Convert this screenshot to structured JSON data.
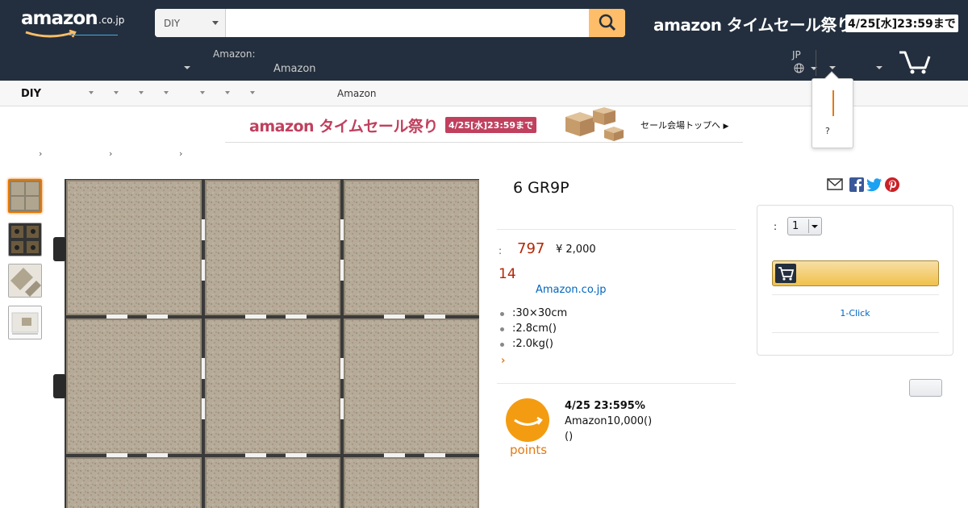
{
  "header": {
    "logo_text": "amazon",
    "logo_tld": ".co.jp",
    "search": {
      "category": "DIY",
      "placeholder": "",
      "value": ""
    },
    "sale_banner": {
      "title": "amazon タイムセール祭り",
      "date": "4/25[水]23:59まで"
    },
    "deliver_to": {
      "label": "Amazon:",
      "value": "Amazon"
    },
    "language": "JP"
  },
  "category_bar": {
    "first": "DIY",
    "amazon_link": "Amazon"
  },
  "popover": {
    "question": "?"
  },
  "promo_banner": {
    "title": "amazon タイムセール祭り",
    "date": "4/25[水]23:59まで",
    "link": "セール会場トップへ"
  },
  "breadcrumb": {
    "separator": "›"
  },
  "product": {
    "title": "6 GR9P",
    "price_label": ":",
    "price": "797",
    "list_price": "¥ 2,000",
    "points": "14",
    "seller": "Amazon.co.jp",
    "bullets": [
      ":30×30cm",
      ":2.8cm()",
      ":2.0kg()"
    ],
    "more": "›"
  },
  "points_promo": {
    "badge": "points",
    "line1": "4/25 23:595%",
    "line2": "Amazon10,000()",
    "line3": "()"
  },
  "buybox": {
    "qty_label": ":",
    "qty_value": "1",
    "one_click": "1-Click"
  },
  "colors": {
    "header_bg": "#232f3e",
    "search_button": "#febd69",
    "price": "#b12704",
    "link": "#0066c0",
    "accent": "#e47911",
    "points_orange": "#f39c12"
  },
  "icons": [
    "search-icon",
    "globe-icon",
    "cart-icon",
    "mail-icon",
    "facebook-icon",
    "twitter-icon",
    "pinterest-icon",
    "cart-button-icon"
  ]
}
